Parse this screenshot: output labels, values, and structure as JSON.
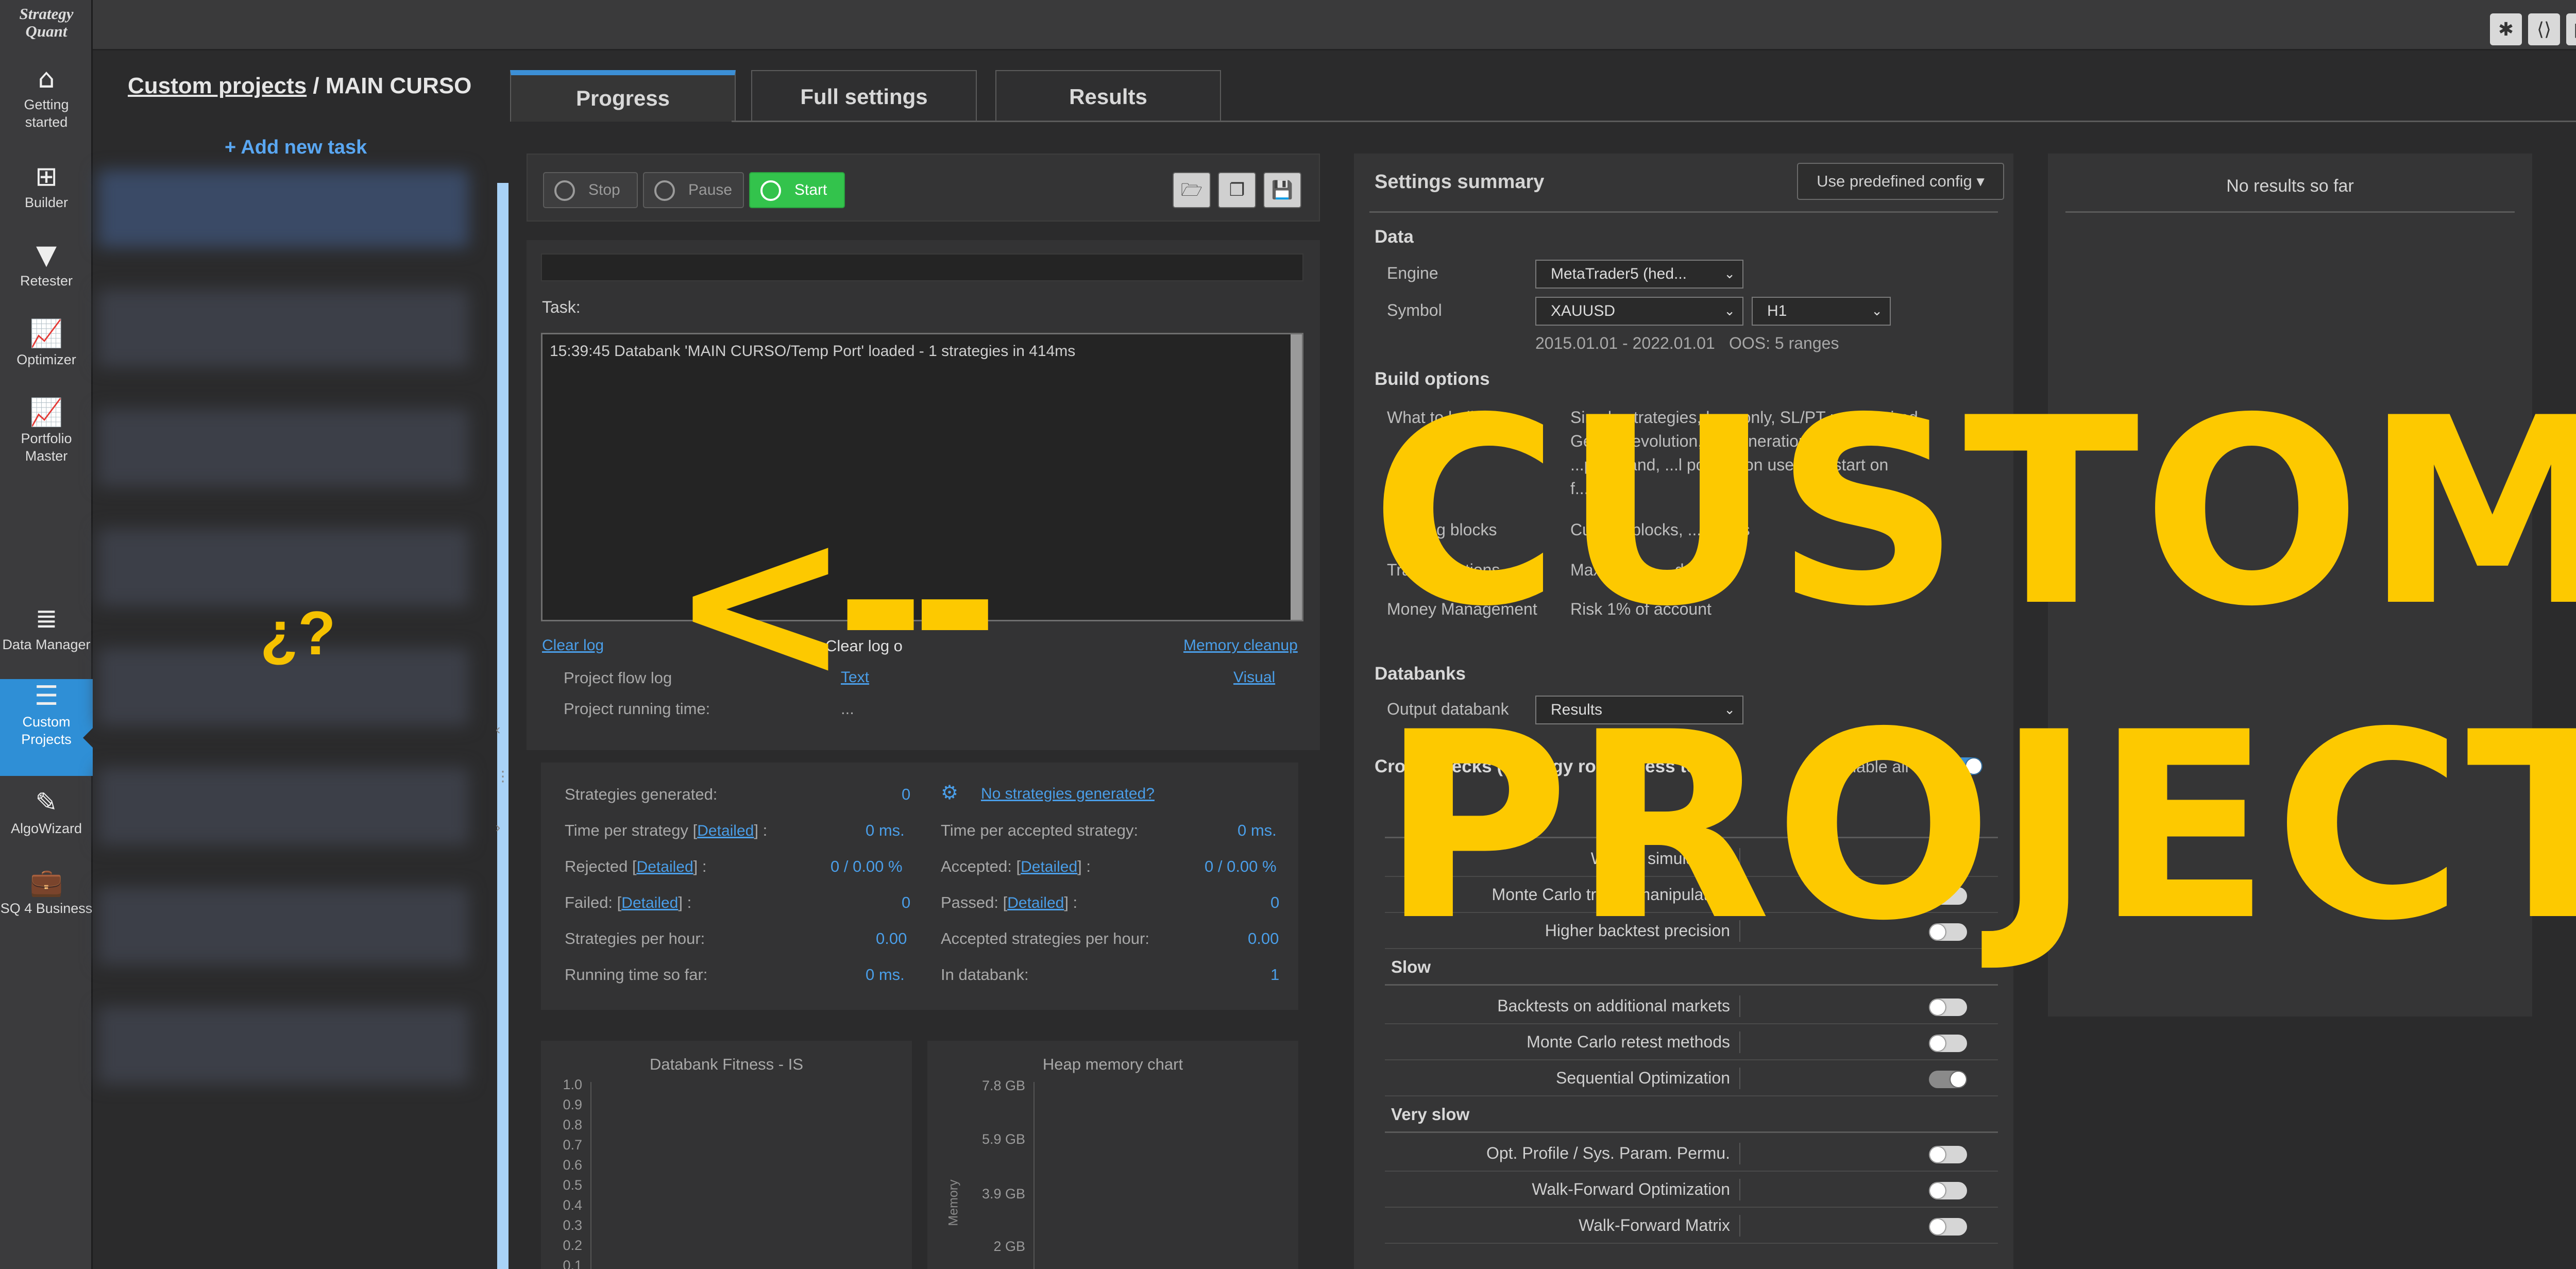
{
  "app": {
    "logo_line1": "Strategy",
    "logo_line2": "Quant",
    "top_icons": [
      "bug-icon",
      "code-icon",
      "grid-icon",
      "gear-icon"
    ]
  },
  "nav": {
    "getting_started_1": "Getting",
    "getting_started_2": "started",
    "builder": "Builder",
    "retester": "Retester",
    "optimizer": "Optimizer",
    "portfolio_1": "Portfolio",
    "portfolio_2": "Master",
    "data_manager": "Data Manager",
    "custom_1": "Custom",
    "custom_2": "Projects",
    "algowizard": "AlgoWizard",
    "sq4b": "SQ 4 Business"
  },
  "breadcrumb": {
    "link": "Custom projects",
    "separator": " / ",
    "current": "MAIN CURSO"
  },
  "tasks": {
    "add_label": "+ Add new task",
    "question": "¿?"
  },
  "tabs": {
    "progress": "Progress",
    "full_settings": "Full settings",
    "results": "Results"
  },
  "toolbar": {
    "stop": "Stop",
    "pause": "Pause",
    "start": "Start",
    "icons": [
      "open-folder-icon",
      "copy-icon",
      "save-icon"
    ]
  },
  "log": {
    "task_label": "Task:",
    "line": "15:39:45 Databank 'MAIN CURSO/Temp Port' loaded - 1 strategies in 414ms",
    "clear_log": "Clear log",
    "clear_log_on": "Clear log o",
    "memory_cleanup": "Memory cleanup",
    "flow_label": "Project flow log",
    "flow_text": "Text",
    "flow_visual": "Visual",
    "running_label": "Project running time:",
    "running_value": "..."
  },
  "stats": {
    "generated_label": "Strategies generated:",
    "generated": "0",
    "time_per_label": "Time per strategy [",
    "detailed": "Detailed",
    "time_per_end": "] :",
    "time_per": "0 ms.",
    "rejected_label": "Rejected [",
    "rejected_end": "] :",
    "rejected": "0 / 0.00 %",
    "failed_label": "Failed: [",
    "failed_end": "] :",
    "failed": "0",
    "per_hour_label": "Strategies per hour:",
    "per_hour": "0.00",
    "running_label": "Running time so far:",
    "running": "0 ms.",
    "no_strat_link": "No strategies generated?",
    "time_accepted_label": "Time per accepted strategy:",
    "time_accepted": "0 ms.",
    "accepted_label": "Accepted: [",
    "accepted_end": "] :",
    "accepted": "0 / 0.00 %",
    "passed_label": "Passed: [",
    "passed_end": "] :",
    "passed": "0",
    "accepted_hour_label": "Accepted strategies per hour:",
    "accepted_hour": "0.00",
    "databank_label": "In databank:",
    "databank": "1"
  },
  "charts": {
    "fitness_title": "Databank Fitness - IS",
    "fitness_ticks": [
      "1.0",
      "0.9",
      "0.8",
      "0.7",
      "0.6",
      "0.5",
      "0.4",
      "0.3",
      "0.2",
      "0.1"
    ],
    "heap_title": "Heap memory chart",
    "heap_ticks": [
      "7.8 GB",
      "5.9 GB",
      "3.9 GB",
      "2 GB"
    ],
    "heap_axis": "Memory"
  },
  "settings": {
    "title": "Settings summary",
    "predefined": "Use predefined config",
    "data": "Data",
    "engine_label": "Engine",
    "engine": "MetaTrader5 (hed...",
    "symbol_label": "Symbol",
    "symbol": "XAUUSD",
    "timeframe": "H1",
    "date_range": "2015.01.01 - 2022.01.01",
    "oos": "OOS: 5 ranges",
    "build_options": "Build options",
    "what_label": "What to build",
    "what_1": "Simple strategies, long only, SL/PT not required",
    "what_2": "Genetic evolution, 10 generations, 44",
    "what_3": "...per island, ...l population used, Restart on",
    "what_4": "f...",
    "blocks_label": "Building blocks",
    "blocks": "Custom blocks, ...t types",
    "trading_label": "Trading options",
    "trading": "Max trades ... day: 1",
    "money_label": "Money Management",
    "money": "Risk 1% of account",
    "databanks": "Databanks",
    "output_label": "Output databank",
    "output": "Results",
    "cross": "Cross checks (strategy robustness tests)",
    "enable_all": "Enable all",
    "whatif": "What If simulations",
    "mc_trades": "Monte Carlo trades manipulation",
    "higher": "Higher backtest precision",
    "slow": "Slow",
    "additional": "Backtests on additional markets",
    "mc_retest": "Monte Carlo retest methods",
    "sequential": "Sequential Optimization",
    "very_slow": "Very slow",
    "opt_profile": "Opt. Profile / Sys. Param. Permu.",
    "wfo": "Walk-Forward Optimization",
    "wfm": "Walk-Forward Matrix"
  },
  "results": {
    "empty": "No results so far"
  },
  "overlay": {
    "arrow": "<--",
    "line1": "CUSTOM",
    "line2": "PROJECT"
  },
  "colors": {
    "accent": "#3c8fd6",
    "start": "#33c34c",
    "overlay": "#fdc900",
    "link": "#4a9ee8"
  }
}
